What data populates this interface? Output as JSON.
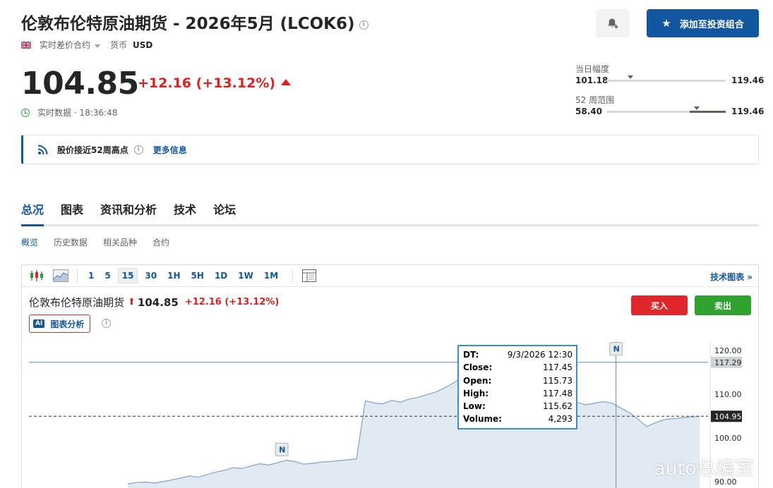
{
  "header": {
    "title": "伦敦布伦特原油期货 - 2026年5月 (LCOK6)",
    "contract_type": "实时差价合约",
    "currency_label": "货币",
    "currency": "USD",
    "add_portfolio_label": "添加至投资组合"
  },
  "quote": {
    "price": "104.85",
    "change": "+12.16 (+13.12%)",
    "status": "实时数据 · 18:36:48"
  },
  "ranges": {
    "day": {
      "label": "当日幅度",
      "low": "101.18",
      "high": "119.46",
      "position": 0.2
    },
    "week52": {
      "label": "52 周范围",
      "low": "58.40",
      "high": "119.46",
      "position": 0.76
    }
  },
  "alert": {
    "text": "股价接近52周高点",
    "more_label": "更多信息"
  },
  "tabs": [
    "总况",
    "图表",
    "资讯和分析",
    "技术",
    "论坛"
  ],
  "subtabs": [
    "概览",
    "历史数据",
    "相关品种",
    "合约"
  ],
  "chart_toolbar": {
    "intervals": [
      "1",
      "5",
      "15",
      "30",
      "1H",
      "5H",
      "1D",
      "1W",
      "1M"
    ],
    "active_interval": "15",
    "tech_chart_label": "技术图表 »"
  },
  "chart": {
    "name": "伦敦布伦特原油期货",
    "price": "104.85",
    "change": "+12.16 (+13.12%)",
    "ai_badge": "AI",
    "ai_label": "图表分析",
    "buy_label": "买入",
    "sell_label": "卖出",
    "news_marker": "N",
    "crosshair_label": "117.29",
    "last_price_label": "104.95"
  },
  "tooltip": {
    "rows": [
      {
        "k": "DT:",
        "v": "9/3/2026 12:30"
      },
      {
        "k": "Close:",
        "v": "117.45"
      },
      {
        "k": "Open:",
        "v": "115.73"
      },
      {
        "k": "High:",
        "v": "117.48"
      },
      {
        "k": "Low:",
        "v": "115.62"
      },
      {
        "k": "Volume:",
        "v": "4,293"
      }
    ]
  },
  "chart_data": {
    "type": "area",
    "y_ticks": [
      120,
      110,
      100,
      90
    ],
    "ylim": [
      88,
      121
    ],
    "crosshair_y": 117.29,
    "last_price": 104.95,
    "x": [
      0,
      4,
      8,
      12,
      16,
      20,
      24,
      28,
      32,
      36,
      40,
      44,
      48,
      52,
      56,
      60,
      64,
      68,
      72,
      76,
      80,
      84,
      88,
      92,
      96,
      100,
      104,
      108,
      112,
      116,
      120,
      124,
      128,
      132,
      136,
      140,
      144,
      148,
      152,
      156,
      160,
      164,
      168,
      172,
      176,
      180,
      184,
      188,
      192,
      196,
      200,
      204,
      208,
      212,
      216,
      220,
      224,
      228,
      232,
      236,
      240,
      244,
      248,
      252,
      256,
      260
    ],
    "values": [
      89.5,
      89.8,
      89.9,
      89.7,
      90.0,
      90.4,
      90.8,
      91.3,
      91.0,
      91.6,
      92.2,
      92.6,
      93.2,
      93.0,
      93.6,
      94.1,
      93.8,
      94.3,
      94.9,
      94.6,
      94.0,
      94.2,
      94.5,
      94.6,
      94.8,
      95.0,
      95.2,
      108.5,
      108.0,
      107.8,
      108.6,
      108.2,
      108.9,
      109.3,
      109.9,
      110.5,
      111.4,
      112.6,
      113.8,
      115.2,
      116.0,
      116.4,
      117.3,
      117.5,
      114.0,
      111.0,
      109.0,
      108.2,
      108.6,
      109.0,
      108.4,
      108.2,
      107.6,
      107.9,
      108.3,
      108.0,
      106.9,
      105.8,
      104.3,
      102.6,
      103.5,
      104.2,
      104.4,
      104.6,
      104.8,
      104.95
    ],
    "news_markers": [
      {
        "x": 70,
        "y": 94.3
      },
      {
        "x": 222,
        "y": 117.3
      }
    ]
  },
  "watermark": "auto总编室"
}
